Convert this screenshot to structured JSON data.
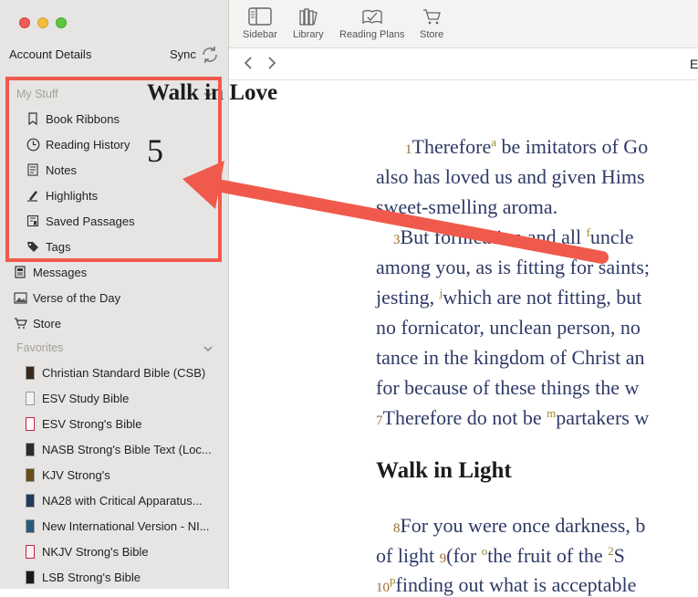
{
  "sidebar": {
    "account_label": "Account Details",
    "sync_label": "Sync",
    "my_stuff": {
      "header": "My Stuff",
      "items": [
        {
          "label": "Book Ribbons",
          "icon": "bookmark-icon"
        },
        {
          "label": "Reading History",
          "icon": "clock-icon"
        },
        {
          "label": "Notes",
          "icon": "note-icon"
        },
        {
          "label": "Highlights",
          "icon": "highlighter-icon"
        },
        {
          "label": "Saved Passages",
          "icon": "saved-passage-icon"
        },
        {
          "label": "Tags",
          "icon": "tag-icon"
        }
      ]
    },
    "other_items": [
      {
        "label": "Messages",
        "icon": "messages-icon"
      },
      {
        "label": "Verse of the Day",
        "icon": "image-icon"
      },
      {
        "label": "Store",
        "icon": "cart-icon"
      }
    ],
    "favorites": {
      "header": "Favorites",
      "books": [
        {
          "label": "Christian Standard Bible (CSB)",
          "color": "#3a2a1c"
        },
        {
          "label": "ESV Study Bible",
          "color": "#f2f2f2"
        },
        {
          "label": "ESV Strong's Bible",
          "color": "#ffffff"
        },
        {
          "label": "NASB Strong's Bible Text (Loc...",
          "color": "#2b2b2b"
        },
        {
          "label": "KJV Strong's",
          "color": "#6b4a1c"
        },
        {
          "label": "NA28 with Critical Apparatus...",
          "color": "#1e3a5c"
        },
        {
          "label": "New International Version - NI...",
          "color": "#2a5a7a"
        },
        {
          "label": "NKJV Strong's Bible",
          "color": "#f4f4f4"
        },
        {
          "label": "LSB Strong's Bible",
          "color": "#1a1a1a"
        }
      ]
    }
  },
  "toolbar": {
    "sidebar_label": "Sidebar",
    "library_label": "Library",
    "reading_plans_label": "Reading Plans",
    "store_label": "Store"
  },
  "nav": {
    "title_fragment": "E"
  },
  "reader": {
    "heading1": "Walk in Love",
    "chapter": "5",
    "v1_num": "1",
    "l1a": "Therefore",
    "l1_sup": "a",
    "l1b": " be imitators of Go",
    "l2": "also has loved us and given Hims",
    "l3": "sweet-smelling aroma.",
    "v3_num": "3",
    "l4a": "But fornication and all ",
    "l4_sup": "f",
    "l4b": "uncle",
    "l5": "among you, as is fitting for saints;",
    "l6a": "jesting, ",
    "l6_sup": "j",
    "l6b": "which are not fitting, but",
    "l7": "no fornicator, unclean person, no",
    "l8": "tance in the kingdom of Christ an",
    "l9": "for because of these things the w",
    "v7_num": "7",
    "l10a": "Therefore do not be ",
    "l10_sup": "m",
    "l10b": "partakers w",
    "heading2": "Walk in Light",
    "v8_num": "8",
    "l11": "For you were once darkness, b",
    "l12a": "of light ",
    "v9_num": "9",
    "l12b": "(for ",
    "l12_sup": "o",
    "l12c": "the fruit of the ",
    "l12_sup2": "2",
    "l12d": "S",
    "v10_num": "10",
    "l13_sup": "p",
    "l13": "finding out what is acceptable"
  },
  "colors": {
    "annotation": "#f05a4c",
    "verse_text": "#2f3a66",
    "verse_number": "#9a6b2e"
  }
}
